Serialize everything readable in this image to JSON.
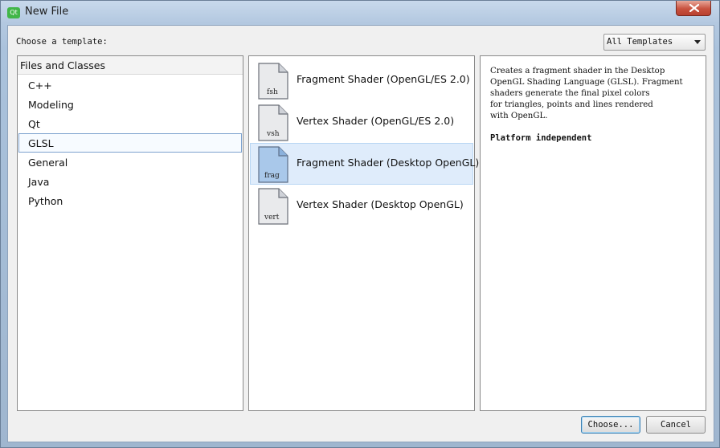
{
  "window": {
    "title": "New File",
    "app_icon": "qt-creator-icon"
  },
  "header": {
    "choose_label": "Choose a template:",
    "filter": {
      "selected": "All Templates"
    }
  },
  "categories": {
    "header": "Files and Classes",
    "items": [
      {
        "label": "C++"
      },
      {
        "label": "Modeling"
      },
      {
        "label": "Qt"
      },
      {
        "label": "GLSL",
        "selected": true
      },
      {
        "label": "General"
      },
      {
        "label": "Java"
      },
      {
        "label": "Python"
      }
    ]
  },
  "templates": {
    "items": [
      {
        "label": "Fragment Shader (OpenGL/ES 2.0)",
        "ext": "fsh"
      },
      {
        "label": "Vertex Shader (OpenGL/ES 2.0)",
        "ext": "vsh"
      },
      {
        "label": "Fragment Shader (Desktop OpenGL)",
        "ext": "frag",
        "selected": true
      },
      {
        "label": "Vertex Shader (Desktop OpenGL)",
        "ext": "vert"
      }
    ]
  },
  "description": {
    "lines": [
      "Creates a fragment shader in the Desktop",
      "OpenGL Shading Language (GLSL). Fragment",
      "shaders generate the final pixel colors",
      "for triangles, points and lines rendered",
      "with OpenGL."
    ],
    "platform": "Platform independent"
  },
  "buttons": {
    "choose": "Choose...",
    "cancel": "Cancel"
  },
  "colors": {
    "selection": "#dfecfb",
    "close_button": "#c8523f",
    "default_button_border": "#3c7fb1"
  }
}
